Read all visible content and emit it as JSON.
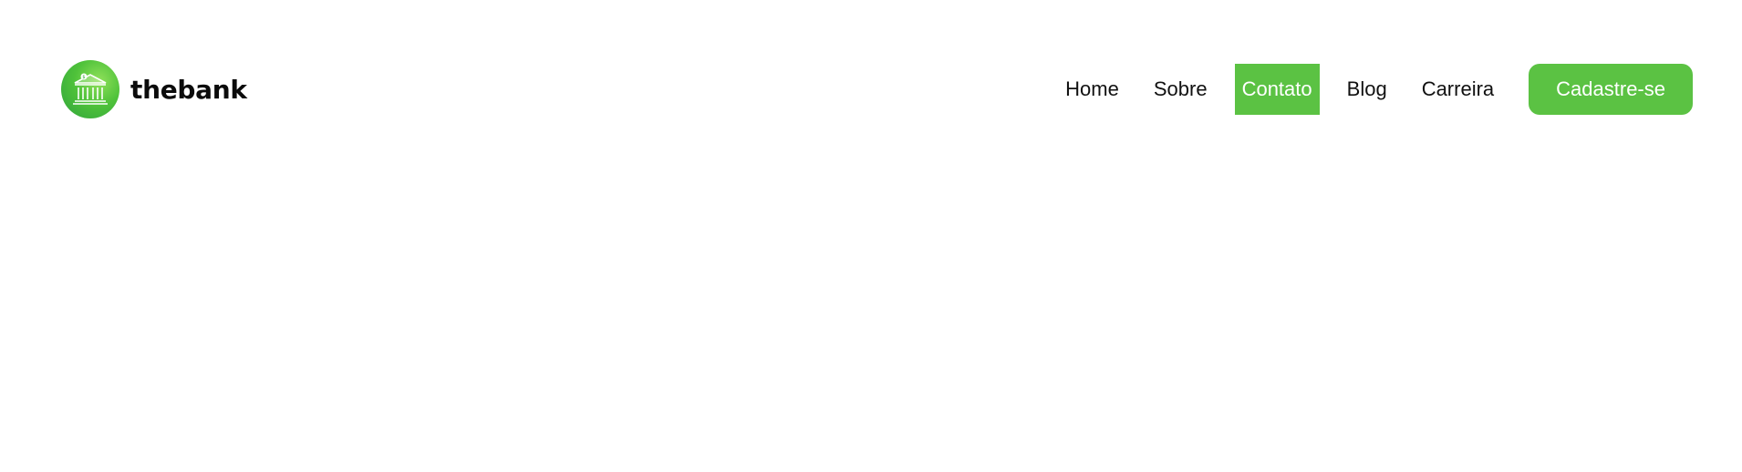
{
  "brand": {
    "name": "thebank",
    "logo_icon": "bank-building-icon"
  },
  "nav": {
    "items": [
      {
        "label": "Home",
        "active": false
      },
      {
        "label": "Sobre",
        "active": false
      },
      {
        "label": "Contato",
        "active": true
      },
      {
        "label": "Blog",
        "active": false
      },
      {
        "label": "Carreira",
        "active": false
      }
    ],
    "cta_label": "Cadastre-se"
  },
  "colors": {
    "accent": "#5bc243",
    "text": "#111111",
    "background": "#ffffff"
  }
}
